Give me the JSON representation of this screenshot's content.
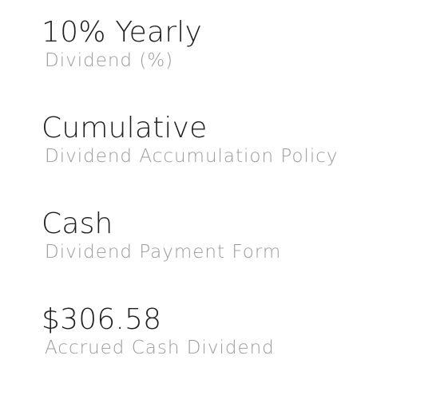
{
  "stats": [
    {
      "value": "10% Yearly",
      "label": "Dividend (%)"
    },
    {
      "value": "Cumulative",
      "label": "Dividend Accumulation Policy"
    },
    {
      "value": "Cash",
      "label": "Dividend Payment Form"
    },
    {
      "value": "$306.58",
      "label": "Accrued Cash Dividend"
    }
  ],
  "colors": {
    "value_text": "#1f1f1f",
    "label_text": "#9a9a9a",
    "background": "#ffffff"
  }
}
